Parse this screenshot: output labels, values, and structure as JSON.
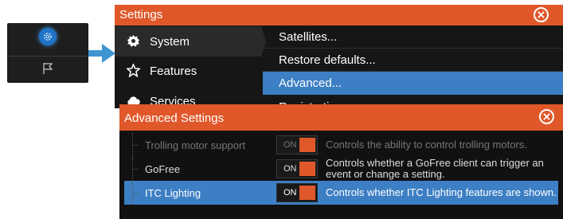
{
  "thumbnail": {
    "gear_icon": "gear-icon",
    "flag_icon": "flag-icon"
  },
  "settings": {
    "title": "Settings",
    "categories": [
      {
        "label": "System",
        "icon": "gear-icon",
        "selected": true
      },
      {
        "label": "Features",
        "icon": "star-icon",
        "selected": false
      },
      {
        "label": "Services",
        "icon": "cloud-icon",
        "selected": false
      }
    ],
    "menu_items": [
      {
        "label": "Satellites...",
        "highlighted": false
      },
      {
        "label": "Restore defaults...",
        "highlighted": false
      },
      {
        "label": "Advanced...",
        "highlighted": true
      },
      {
        "label": "Registration",
        "highlighted": false
      }
    ]
  },
  "advanced": {
    "title": "Advanced Settings",
    "rows": [
      {
        "name": "Trolling motor support",
        "state": "ON",
        "description": "Controls the ability to control trolling motors.",
        "style": "dim"
      },
      {
        "name": "GoFree",
        "state": "ON",
        "description": "Controls whether a GoFree client can trigger an event or change a setting.",
        "style": "normal"
      },
      {
        "name": "ITC Lighting",
        "state": "ON",
        "description": "Controls whether ITC Lighting features are shown.",
        "style": "selected"
      }
    ]
  },
  "colors": {
    "accent": "#e0582a",
    "highlight": "#3d7fc4",
    "arrow": "#3f95d2"
  }
}
